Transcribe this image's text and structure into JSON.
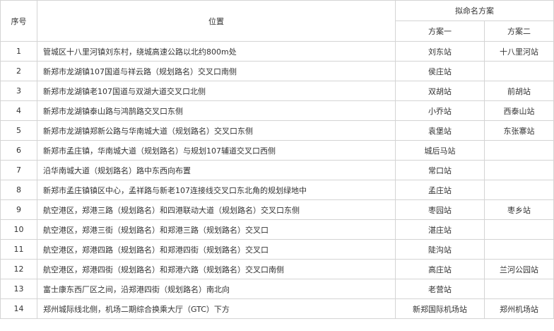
{
  "table": {
    "headers": {
      "index": "序号",
      "location": "位置",
      "proposal_group": "拟命名方案",
      "plan1": "方案一",
      "plan2": "方案二"
    },
    "rows": [
      {
        "no": "1",
        "location": "管城区十八里河镇刘东村，绕城高速公路以北约800m处",
        "plan1": "刘东站",
        "plan2": "十八里河站"
      },
      {
        "no": "2",
        "location": "新郑市龙湖镇107国道与祥云路（规划路名）交叉口南侧",
        "plan1": "侯庄站",
        "plan2": ""
      },
      {
        "no": "3",
        "location": "新郑市龙湖镇老107国道与双湖大道交叉口北侧",
        "plan1": "双胡站",
        "plan2": "前胡站"
      },
      {
        "no": "4",
        "location": "新郑市龙湖镇泰山路与鸿鹄路交叉口东侧",
        "plan1": "小乔站",
        "plan2": "西泰山站"
      },
      {
        "no": "5",
        "location": "新郑市龙湖镇郑新公路与华南城大道（规划路名）交叉口东侧",
        "plan1": "袁堡站",
        "plan2": "东张寨站"
      },
      {
        "no": "6",
        "location": "新郑市孟庄镇，华南城大道（规划路名）与规划107辅道交叉口西侧",
        "plan1": "城后马站",
        "plan2": ""
      },
      {
        "no": "7",
        "location": "沿华南城大道（规划路名）路中东西向布置",
        "plan1": "常口站",
        "plan2": ""
      },
      {
        "no": "8",
        "location": "新郑市孟庄镇镇区中心，孟祥路与新老107连接线交叉口东北角的规划绿地中",
        "plan1": "孟庄站",
        "plan2": ""
      },
      {
        "no": "9",
        "location": "航空港区，郑港三路（规划路名）和四港联动大道（规划路名）交叉口东侧",
        "plan1": "枣园站",
        "plan2": "枣乡站"
      },
      {
        "no": "10",
        "location": "航空港区，郑港三街（规划路名）和郑港三路（规划路名）交叉口",
        "plan1": "湛庄站",
        "plan2": ""
      },
      {
        "no": "11",
        "location": "航空港区，郑港四路（规划路名）和郑港四街（规划路名）交叉口",
        "plan1": "陡沟站",
        "plan2": ""
      },
      {
        "no": "12",
        "location": "航空港区，郑港四街（规划路名）和郑港六路（规划路名）交叉口南侧",
        "plan1": "高庄站",
        "plan2": "兰河公园站"
      },
      {
        "no": "13",
        "location": "富士康东西厂区之间，沿郑港四街（规划路名）南北向",
        "plan1": "老营站",
        "plan2": ""
      },
      {
        "no": "14",
        "location": "郑州城际线北侧，机场二期综合换乘大厅（GTC）下方",
        "plan1": "新郑国际机场站",
        "plan2": "郑州机场站"
      }
    ]
  }
}
